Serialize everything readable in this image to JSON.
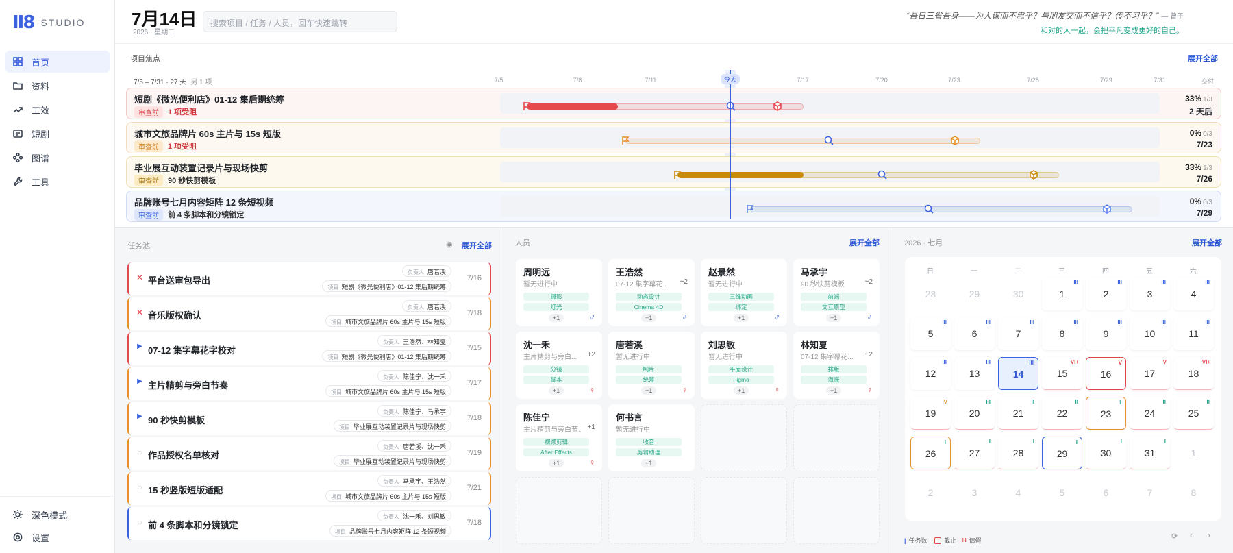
{
  "app": {
    "logo_mark": "II8",
    "logo_text": "STUDIO"
  },
  "nav": [
    {
      "label": "首页",
      "icon": "grid-icon"
    },
    {
      "label": "资料",
      "icon": "folder-icon"
    },
    {
      "label": "工效",
      "icon": "trend-icon"
    },
    {
      "label": "短剧",
      "icon": "clapper-icon"
    },
    {
      "label": "图谱",
      "icon": "graph-icon"
    },
    {
      "label": "工具",
      "icon": "wrench-icon"
    }
  ],
  "nav_bottom": [
    {
      "label": "深色模式",
      "icon": "sun-icon"
    },
    {
      "label": "设置",
      "icon": "gear-icon"
    }
  ],
  "header": {
    "date": "7月14日",
    "sub": "2026 · 星期二",
    "search_placeholder": "搜索项目 / 任务 / 人员，回车快速跳转",
    "quote": "“吾日三省吾身——为人谋而不忠乎？与朋友交而不信乎？传不习乎？”",
    "quote_author": "— 曾子",
    "slogan": "和对的人一起，会把平凡变成更好的自己。"
  },
  "projects": {
    "title": "项目焦点",
    "expand": "展开全部",
    "range": "7/5 – 7/31 · 27 天",
    "range_note": "另 1 项",
    "ticks": [
      "7/5",
      "7/8",
      "7/11",
      "今天",
      "7/17",
      "7/20",
      "7/23",
      "7/26",
      "7/29",
      "7/31"
    ],
    "deliver": "交付",
    "items": [
      {
        "title": "短剧《微光便利店》01-12 集后期统筹",
        "status": "审查前",
        "note": "1 项受阻",
        "progress": "33%",
        "count": "1/3",
        "due": "2 天后",
        "color": "#e5484d",
        "pct": 0.33
      },
      {
        "title": "城市文旅品牌片 60s 主片与 15s 短版",
        "status": "审查前",
        "note": "1 项受阻",
        "progress": "0%",
        "count": "0/3",
        "due": "7/23",
        "color": "#e8902b",
        "pct": 0
      },
      {
        "title": "毕业展互动装置记录片与现场快剪",
        "status": "审查前",
        "note": "90 秒快剪模板",
        "progress": "33%",
        "count": "1/3",
        "due": "7/26",
        "color": "#c98a09",
        "pct": 0.33
      },
      {
        "title": "品牌账号七月内容矩阵 12 条短视频",
        "status": "审查前",
        "note": "前 4 条脚本和分镜锁定",
        "progress": "0%",
        "count": "0/3",
        "due": "7/29",
        "color": "#5b7fe3",
        "pct": 0
      }
    ]
  },
  "tasks": {
    "title": "任务池",
    "expand": "展开全部",
    "owner_label": "负责人",
    "project_label": "项目",
    "items": [
      {
        "name": "平台送审包导出",
        "owner": "唐若溪",
        "project": "短剧《微光便利店》01-12 集后期统筹",
        "date": "7/16",
        "state": "✕"
      },
      {
        "name": "音乐版权确认",
        "owner": "唐若溪",
        "project": "城市文旅品牌片 60s 主片与 15s 短版",
        "date": "7/18",
        "state": "✕"
      },
      {
        "name": "07-12 集字幕花字校对",
        "owner": "王浩然、林知夏",
        "project": "短剧《微光便利店》01-12 集后期统筹",
        "date": "7/15",
        "state": "▶"
      },
      {
        "name": "主片精剪与旁白节奏",
        "owner": "陈佳宁、沈一禾",
        "project": "城市文旅品牌片 60s 主片与 15s 短版",
        "date": "7/17",
        "state": "▶"
      },
      {
        "name": "90 秒快剪模板",
        "owner": "陈佳宁、马承宇",
        "project": "毕业展互动装置记录片与现场快剪",
        "date": "7/18",
        "state": "▶"
      },
      {
        "name": "作品授权名单核对",
        "owner": "唐若溪、沈一禾",
        "project": "毕业展互动装置记录片与现场快剪",
        "date": "7/19",
        "state": "○"
      },
      {
        "name": "15 秒竖版短版适配",
        "owner": "马承宇、王浩然",
        "project": "城市文旅品牌片 60s 主片与 15s 短版",
        "date": "7/21",
        "state": "○"
      },
      {
        "name": "前 4 条脚本和分镜锁定",
        "owner": "沈一禾、刘思敏",
        "project": "品牌账号七月内容矩阵 12 条短视频",
        "date": "7/18",
        "state": "○"
      }
    ]
  },
  "people": {
    "title": "人员",
    "expand": "展开全部",
    "more": "+1",
    "items": [
      {
        "name": "周明远",
        "task": "暂无进行中",
        "extra": "",
        "tags": [
          "摄影",
          "灯光"
        ],
        "sex": "♂"
      },
      {
        "name": "王浩然",
        "task": "07-12 集字幕花...",
        "extra": "+2",
        "tags": [
          "动态设计",
          "Cinema 4D"
        ],
        "sex": "♂"
      },
      {
        "name": "赵景然",
        "task": "暂无进行中",
        "extra": "",
        "tags": [
          "三维动画",
          "绑定"
        ],
        "sex": "♂"
      },
      {
        "name": "马承宇",
        "task": "90 秒快剪模板",
        "extra": "+2",
        "tags": [
          "前端",
          "交互原型"
        ],
        "sex": "♂"
      },
      {
        "name": "沈一禾",
        "task": "主片精剪与旁白...",
        "extra": "+2",
        "tags": [
          "分镜",
          "脚本"
        ],
        "sex": "♀"
      },
      {
        "name": "唐若溪",
        "task": "暂无进行中",
        "extra": "",
        "tags": [
          "制片",
          "统筹"
        ],
        "sex": "♀"
      },
      {
        "name": "刘思敏",
        "task": "暂无进行中",
        "extra": "",
        "tags": [
          "平面设计",
          "Figma"
        ],
        "sex": "♀"
      },
      {
        "name": "林知夏",
        "task": "07-12 集字幕花...",
        "extra": "+2",
        "tags": [
          "排版",
          "海报"
        ],
        "sex": "♀"
      },
      {
        "name": "陈佳宁",
        "task": "主片精剪与旁白节...",
        "extra": "+1",
        "tags": [
          "视频剪辑",
          "After Effects"
        ],
        "sex": "♀"
      },
      {
        "name": "何书言",
        "task": "暂无进行中",
        "extra": "",
        "tags": [
          "收音",
          "剪辑助理"
        ],
        "sex": ""
      }
    ]
  },
  "calendar": {
    "title": "2026 · 七月",
    "expand": "展开全部",
    "weekdays": [
      "日",
      "一",
      "二",
      "三",
      "四",
      "五",
      "六"
    ],
    "days": [
      "28",
      "29",
      "30",
      "1",
      "2",
      "3",
      "4",
      "5",
      "6",
      "7",
      "8",
      "9",
      "10",
      "11",
      "12",
      "13",
      "14",
      "15",
      "16",
      "17",
      "18",
      "19",
      "20",
      "21",
      "22",
      "23",
      "24",
      "25",
      "26",
      "27",
      "28",
      "29",
      "30",
      "31",
      "1",
      "2",
      "3",
      "4",
      "5",
      "6",
      "7",
      "8"
    ],
    "counts": [
      "",
      "",
      "",
      "III",
      "III",
      "III",
      "III",
      "III",
      "III",
      "III",
      "III",
      "III",
      "III",
      "III",
      "III",
      "III",
      "III",
      "",
      "",
      "",
      "",
      "",
      "III",
      "II",
      "II",
      "II",
      "II",
      "II",
      "I",
      "I",
      "I",
      "I",
      "I",
      "I",
      "",
      "",
      "",
      "",
      "",
      "",
      "",
      ""
    ],
    "marks": [
      "",
      "",
      "",
      "",
      "",
      "",
      "",
      "",
      "",
      "",
      "",
      "",
      "",
      "",
      "",
      "",
      "",
      "VI+",
      "V",
      "V",
      "VI+",
      "IV",
      "",
      "",
      "",
      "",
      "",
      "",
      "",
      "",
      "",
      "",
      "",
      "",
      "",
      "",
      "",
      "",
      "",
      "",
      "",
      ""
    ],
    "legend": [
      "任务数",
      "截止",
      "请假"
    ]
  }
}
